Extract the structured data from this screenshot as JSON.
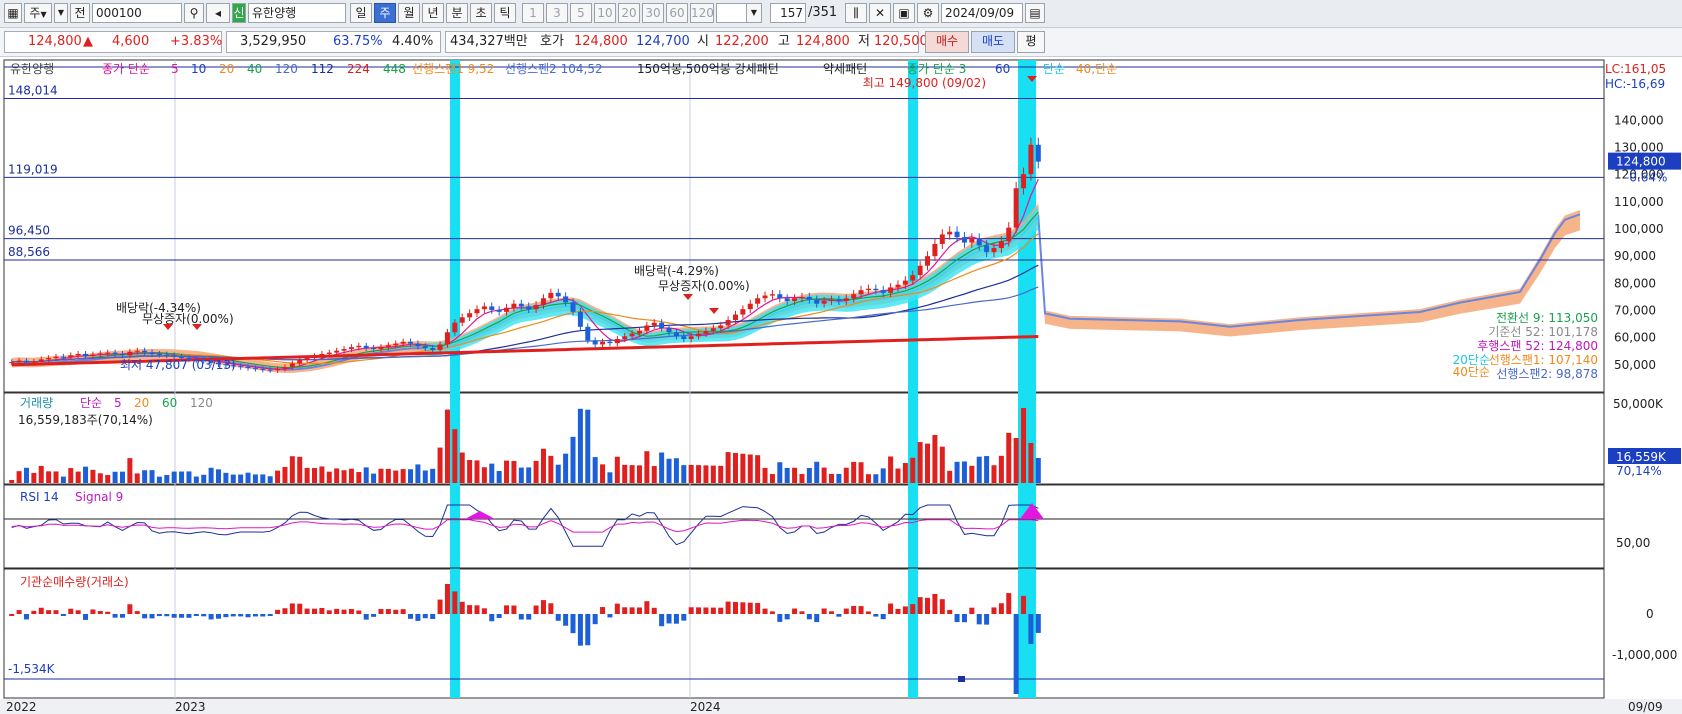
{
  "toolbar": {
    "period_select": "주",
    "prev_label": "전",
    "code": "000100",
    "badge": "신",
    "stock_name": "유한양행",
    "periods": [
      "일",
      "주",
      "월",
      "년",
      "분",
      "초",
      "틱"
    ],
    "active_period": "주",
    "intervals": [
      "1",
      "3",
      "5",
      "10",
      "20",
      "30",
      "60",
      "120"
    ],
    "count": "157",
    "total": "/351",
    "date": "2024/09/09"
  },
  "quote": {
    "price": "124,800",
    "arrow": "▲",
    "change": "4,600",
    "change_pct": "+3.83%",
    "volume": "3,529,950",
    "vol_ratio": "63.75%",
    "turnover": "4.40%",
    "amount": "434,327백만",
    "hoga_label": "호가",
    "ask": "124,800",
    "bid": "124,700",
    "open_label": "시",
    "open": "122,200",
    "high_label": "고",
    "high": "124,800",
    "low_label": "저",
    "low": "120,500",
    "buy_label": "매수",
    "sell_label": "매도",
    "eval_label": "평"
  },
  "price_panel": {
    "stock": "유한양행",
    "legend_ma": "종가 단순",
    "ma_periods": [
      {
        "label": "5",
        "color": "#e0189a"
      },
      {
        "label": "10",
        "color": "#1c3fc2"
      },
      {
        "label": "20",
        "color": "#f08a1c"
      },
      {
        "label": "40",
        "color": "#16a34a"
      },
      {
        "label": "120",
        "color": "#4a6ac8"
      },
      {
        "label": "112",
        "color": "#1c2f9a"
      },
      {
        "label": "224",
        "color": "#e0201e"
      },
      {
        "label": "448",
        "color": "#16a34a"
      }
    ],
    "span1": "선행스팬1 9,52",
    "span2": "선행스팬2 104,52",
    "pattern": "150억봉,500억봉 강세패턴",
    "weak": "약세패턴",
    "ma2": "종가 단순 3",
    "ma2_b": "60",
    "ma2_c": "단순",
    "ma2_d": "40,단순",
    "lc": "LC:161,05",
    "hc": "HC:-16,69",
    "hlines": [
      {
        "label": "148,014",
        "value": 148014
      },
      {
        "label": "119,019",
        "value": 119019
      },
      {
        "label": "96,450",
        "value": 96450
      },
      {
        "label": "88,566",
        "value": 88566
      }
    ],
    "high_note": "최고 149,800 (09/02)",
    "low_note": "최저 47,807 (03/13)",
    "events": [
      {
        "label": "배당락(-4.34%)"
      },
      {
        "label": "무상증자(0.00%)"
      },
      {
        "label": "배당락(-4.29%)"
      },
      {
        "label": "무상증자(0.00%)"
      }
    ],
    "y_ticks": [
      "140,000",
      "130,000",
      "120,000",
      "110,000",
      "100,000",
      "90,000",
      "80,000",
      "70,000",
      "60,000",
      "50,000"
    ],
    "current_price": "124,800",
    "current_pct": "-0.64%",
    "ichimoku": [
      {
        "label": "전환선 9: 113,050",
        "color": "#16a34a"
      },
      {
        "label": "기준선 52: 101,178",
        "color": "#8a8a8a"
      },
      {
        "label": "후행스팬 52: 124,800",
        "color": "#c018c0"
      },
      {
        "label": "선행스팬1: 107,140",
        "color": "#f08a1c"
      },
      {
        "label": "선행스팬2: 98,878",
        "color": "#4a6ac8"
      }
    ],
    "ma_right": [
      {
        "label": "20단순",
        "color": "#19c8e8"
      },
      {
        "label": "40단순",
        "color": "#f08a1c"
      }
    ]
  },
  "volume_panel": {
    "title": "거래량",
    "legend": "단순",
    "periods": [
      {
        "label": "5",
        "color": "#c018c0"
      },
      {
        "label": "20",
        "color": "#f08a1c"
      },
      {
        "label": "60",
        "color": "#16a34a"
      },
      {
        "label": "120",
        "color": "#8a8a8a"
      }
    ],
    "current": "16,559,183주(70,14%)",
    "y_tick": "50,000K",
    "tag": "16,559K",
    "tag_pct": "70,14%"
  },
  "rsi_panel": {
    "title": "RSI 14",
    "signal": "Signal 9",
    "y_tick": "50,00"
  },
  "inst_panel": {
    "title": "기관순매수량(거래소)",
    "y_ticks": [
      "0",
      "-1,000,000"
    ],
    "min_label": "-1,534K"
  },
  "x_axis": {
    "labels": [
      "2022",
      "2023",
      "2024"
    ],
    "right_label": "09/09"
  },
  "chart_data": {
    "type": "candlestick",
    "frequency": "weekly",
    "ylim": [
      40000,
      160000
    ],
    "close_weekly": [
      51000,
      51500,
      50800,
      51200,
      52000,
      52500,
      53000,
      52800,
      53500,
      54000,
      53200,
      53800,
      54200,
      54500,
      54000,
      53500,
      54800,
      55200,
      54600,
      54000,
      53800,
      53500,
      53000,
      52500,
      52000,
      51800,
      51500,
      50800,
      50200,
      49800,
      49500,
      49200,
      48800,
      48500,
      48200,
      48000,
      48500,
      49200,
      50500,
      51800,
      52500,
      53200,
      54000,
      54500,
      55200,
      55800,
      56500,
      57000,
      56200,
      55800,
      56500,
      57200,
      57800,
      58500,
      57800,
      56800,
      56200,
      55500,
      57500,
      62000,
      65500,
      67500,
      69000,
      70500,
      71500,
      70200,
      69500,
      71000,
      72500,
      71500,
      70500,
      72000,
      74500,
      76500,
      75200,
      73000,
      69500,
      64000,
      59000,
      57500,
      58500,
      58000,
      59500,
      60500,
      61500,
      62500,
      64500,
      65500,
      63500,
      62000,
      60500,
      59500,
      60500,
      61500,
      62500,
      63500,
      64500,
      66500,
      68500,
      70500,
      72500,
      74500,
      75500,
      76000,
      74500,
      73500,
      74500,
      75000,
      74000,
      72500,
      73500,
      74000,
      73500,
      74500,
      76000,
      77500,
      78000,
      77500,
      76500,
      78500,
      79500,
      81000,
      83000,
      86500,
      90000,
      94500,
      98000,
      99000,
      97000,
      95000,
      96500,
      94000,
      91500,
      93000,
      95500,
      100500,
      115000,
      120200,
      131000,
      124800
    ],
    "events": [
      "배당락(-4.34%)",
      "무상증자(0.00%)",
      "배당락(-4.29%)",
      "무상증자(0.00%)"
    ]
  }
}
